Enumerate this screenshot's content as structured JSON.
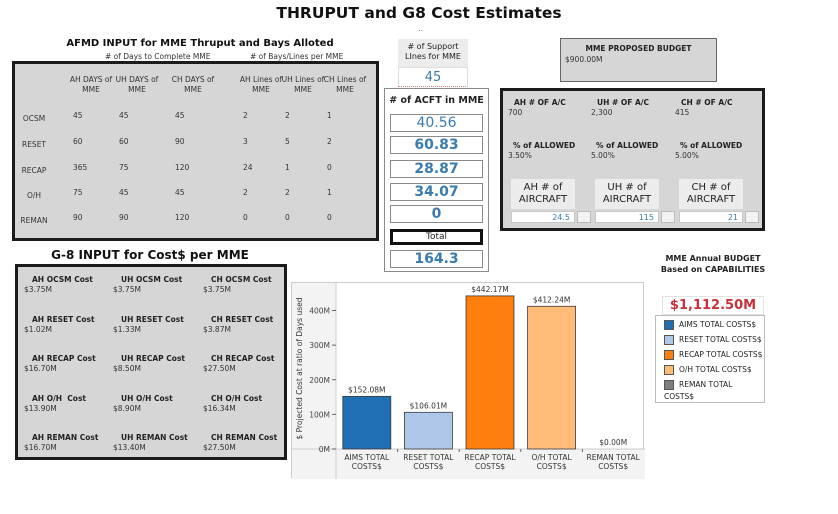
{
  "header": {
    "title": "THRUPUT and G8 Cost Estimates",
    "dots": ".."
  },
  "afmd": {
    "title": "AFMD INPUT for MME Thruput and Bays Alloted",
    "sub_days": "# of Days to Complete MME",
    "sub_lines": "# of Bays/Lines per MME",
    "columns": [
      "AH DAYS of MME",
      "UH DAYS of MME",
      "CH DAYS of MME",
      "AH Lines of MME",
      "UH Lines of MME",
      "CH Lines of MME"
    ],
    "rows": [
      {
        "label": "OCSM",
        "values": [
          "45",
          "45",
          "45",
          "2",
          "2",
          "1"
        ]
      },
      {
        "label": "RESET",
        "values": [
          "60",
          "60",
          "90",
          "3",
          "5",
          "2"
        ]
      },
      {
        "label": "RECAP",
        "values": [
          "365",
          "75",
          "120",
          "24",
          "1",
          "0"
        ]
      },
      {
        "label": "O/H",
        "values": [
          "75",
          "45",
          "45",
          "2",
          "2",
          "1"
        ]
      },
      {
        "label": "REMAN",
        "values": [
          "90",
          "90",
          "120",
          "0",
          "0",
          "0"
        ]
      }
    ]
  },
  "support_lines": {
    "label": "# of Support LInes for MME",
    "value": "45"
  },
  "acft": {
    "title": "# of ACFT in MME",
    "values": [
      "40.56",
      "60.83",
      "28.87",
      "34.07",
      "0"
    ],
    "total_label": "Total",
    "total": "164.3"
  },
  "budget": {
    "label": "MME PROPOSED BUDGET",
    "value": "$900.00M"
  },
  "aircraft_panel": {
    "counts": [
      {
        "label": "AH # OF A/C",
        "value": "700"
      },
      {
        "label": "UH # OF A/C",
        "value": "2,300"
      },
      {
        "label": "CH # OF A/C",
        "value": "415"
      }
    ],
    "allowed": [
      {
        "label": "% of ALLOWED",
        "value": "3.50%"
      },
      {
        "label": "% of ALLOWED",
        "value": "5.00%"
      },
      {
        "label": "% of ALLOWED",
        "value": "5.00%"
      }
    ],
    "inputs": [
      {
        "label": "AH # of AIRCRAFT",
        "value": "24.5"
      },
      {
        "label": "UH # of AIRCRAFT",
        "value": "115"
      },
      {
        "label": "CH # of AIRCRAFT",
        "value": "21"
      }
    ]
  },
  "g8": {
    "title": "G-8 INPUT for Cost$ per MME",
    "rows": [
      [
        {
          "label": "AH OCSM Cost",
          "value": "$3.75M"
        },
        {
          "label": "UH OCSM Cost",
          "value": "$3.75M"
        },
        {
          "label": "CH OCSM Cost",
          "value": "$3.75M"
        }
      ],
      [
        {
          "label": "AH RESET Cost",
          "value": "$1.02M"
        },
        {
          "label": "UH RESET Cost",
          "value": "$1.33M"
        },
        {
          "label": "CH RESET Cost",
          "value": "$3.87M"
        }
      ],
      [
        {
          "label": "AH RECAP Cost",
          "value": "$16.70M"
        },
        {
          "label": "UH RECAP Cost",
          "value": "$8.50M"
        },
        {
          "label": "CH RECAP Cost",
          "value": "$27.50M"
        }
      ],
      [
        {
          "label": "AH O/H  Cost",
          "value": "$13.90M"
        },
        {
          "label": "UH O/H Cost",
          "value": "$8.90M"
        },
        {
          "label": "CH O/H Cost",
          "value": "$16.34M"
        }
      ],
      [
        {
          "label": "AH REMAN Cost",
          "value": "$16.70M"
        },
        {
          "label": "UH REMAN Cost",
          "value": "$13.40M"
        },
        {
          "label": "CH REMAN Cost",
          "value": "$27.50M"
        }
      ]
    ]
  },
  "annual": {
    "title": "MME Annual BUDGET Based on CAPABILITIES",
    "value": "$1,112.50M",
    "value_color": "#c8303a"
  },
  "chart_data": {
    "type": "bar",
    "title": "",
    "xlabel": "",
    "ylabel": "$ Projected Cost at ratio of Days used",
    "categories": [
      "AIMS TOTAL COSTS$",
      "RESET TOTAL COSTS$",
      "RECAP TOTAL COSTS$",
      "O/H TOTAL COSTS$",
      "REMAN TOTAL COSTS$"
    ],
    "category_lines": [
      [
        "AIMS TOTAL",
        "COSTS$"
      ],
      [
        "RESET TOTAL",
        "COSTS$"
      ],
      [
        "RECAP TOTAL",
        "COSTS$"
      ],
      [
        "O/H TOTAL",
        "COSTS$"
      ],
      [
        "REMAN TOTAL",
        "COSTS$"
      ]
    ],
    "values": [
      152.08,
      106.01,
      442.17,
      412.24,
      0.0
    ],
    "data_labels": [
      "$152.08M",
      "$106.01M",
      "$442.17M",
      "$412.24M",
      "$0.00M"
    ],
    "colors": [
      "#1f6fb2",
      "#aec7e8",
      "#ff7f0e",
      "#ffbb78",
      "#7f7f7f"
    ],
    "yticks": [
      0,
      100,
      200,
      300,
      400
    ],
    "ytick_labels": [
      "0M",
      "100M",
      "200M",
      "300M",
      "400M"
    ],
    "ylim": [
      0,
      465
    ],
    "grid": false,
    "legend": {
      "placement": "right",
      "entries": [
        "AIMS TOTAL COSTS$",
        "RESET TOTAL COSTS$",
        "RECAP TOTAL COSTS$",
        "O/H TOTAL COSTS$",
        "REMAN TOTAL COSTS$"
      ]
    }
  }
}
